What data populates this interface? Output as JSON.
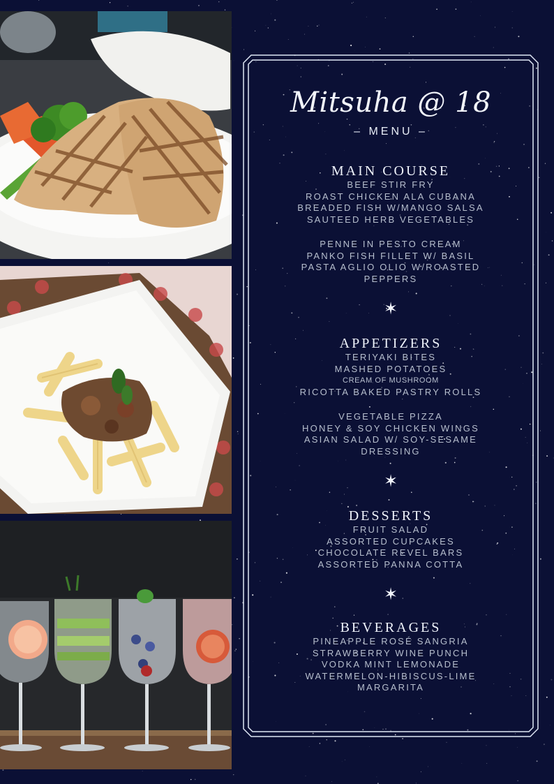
{
  "menu": {
    "title": "Mitsuha @ 18",
    "subtitle": "– MENU –",
    "sections": [
      {
        "title": "MAIN COURSE",
        "groups": [
          [
            "BEEF STIR FRY",
            "ROAST CHICKEN ALA CUBANA",
            "BREADED FISH W/MANGO SALSA",
            "SAUTEED HERB VEGETABLES"
          ],
          [
            "PENNE IN PESTO CREAM",
            "PANKO FISH FILLET W/ BASIL",
            "PASTA AGLIO OLIO W/ROASTED",
            "PEPPERS"
          ]
        ]
      },
      {
        "title": "APPETIZERS",
        "groups": [
          [
            "TERIYAKI BITES",
            "MASHED POTATOES",
            "CREAM OF MUSHROOM",
            "RICOTTA BAKED PASTRY ROLLS"
          ],
          [
            "VEGETABLE PIZZA",
            "HONEY & SOY CHICKEN WINGS",
            "ASIAN SALAD W/ SOY-SESAME",
            "DRESSING"
          ]
        ]
      },
      {
        "title": "DESSERTS",
        "groups": [
          [
            "FRUIT SALAD",
            "ASSORTED CUPCAKES",
            "CHOCOLATE REVEL BARS",
            "ASSORTED PANNA COTTA"
          ]
        ]
      },
      {
        "title": "BEVERAGES",
        "groups": [
          [
            "PINEAPPLE ROSÉ SANGRIA",
            "STRAWBERRY WINE PUNCH",
            "VODKA MINT LEMONADE",
            "WATERMELON-HIBISCUS-LIME",
            "MARGARITA"
          ]
        ]
      }
    ],
    "divider_icon": "star-icon",
    "divider_glyph": "✶"
  },
  "photos": [
    {
      "name": "grilled-chicken-photo"
    },
    {
      "name": "penne-pasta-photo"
    },
    {
      "name": "cocktail-glasses-photo"
    }
  ],
  "colors": {
    "background": "#0b1035",
    "frame": "#dfe7f5",
    "title": "#f2f5fb",
    "items": "#b7bfce"
  }
}
